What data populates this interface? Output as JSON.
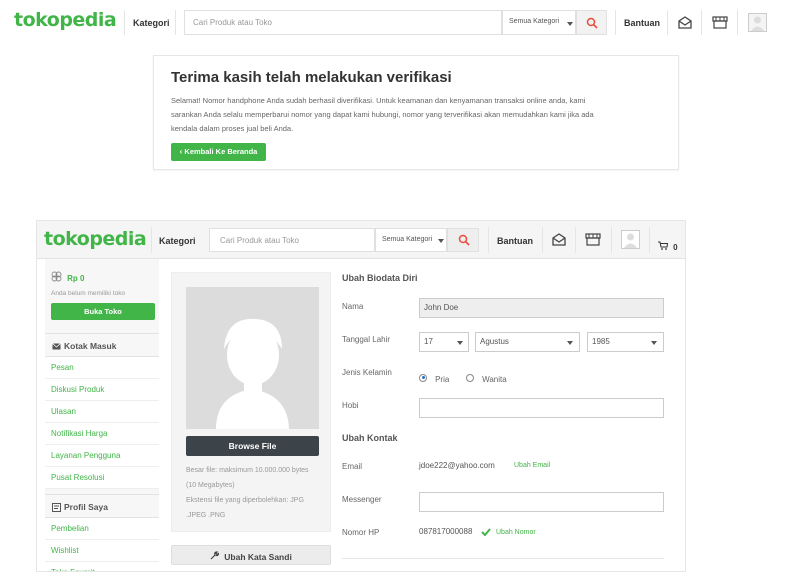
{
  "top_header": {
    "logo": "tokopedia",
    "kategori": "Kategori",
    "search_placeholder": "Cari Produk atau Toko",
    "category_select": "Semua Kategori",
    "bantuan": "Bantuan"
  },
  "verification": {
    "title": "Terima kasih telah melakukan verifikasi",
    "body_line1": "Selamat! Nomor handphone Anda sudah berhasil diverifikasi. Untuk keamanan dan kenyamanan transaksi online anda, kami",
    "body_line2": "sarankan Anda selalu memperbarui nomor yang dapat kami hubungi, nomor yang terverifikasi akan memudahkan kami jika ada",
    "body_line3": "kendala dalam proses jual beli Anda.",
    "back_button": "Kembali Ke Beranda"
  },
  "bottom_header": {
    "logo": "tokopedia",
    "kategori": "Kategori",
    "search_placeholder": "Cari Produk atau Toko",
    "category_select": "Semua Kategori",
    "bantuan": "Bantuan",
    "cart_count": "0"
  },
  "sidebar": {
    "balance": "Rp 0",
    "no_shop_text": "Anda belum memiliki toko",
    "open_shop_button": "Buka Toko",
    "inbox_title": "Kotak Masuk",
    "inbox_items": [
      "Pesan",
      "Diskusi Produk",
      "Ulasan",
      "Notifikasi Harga",
      "Layanan Pengguna",
      "Pusat Resolusi"
    ],
    "profile_title": "Profil Saya",
    "profile_items": [
      "Pembelian",
      "Wishlist",
      "Toko Favorit"
    ]
  },
  "photo": {
    "browse_button": "Browse File",
    "size_line1": "Besar file: maksimum 10.000.000 bytes",
    "size_line2": "(10 Megabytes)",
    "ext_line1": "Ekstensi file yang diperbolehkan: JPG",
    "ext_line2": ".JPEG .PNG",
    "change_password_button": "Ubah Kata Sandi"
  },
  "form": {
    "biodata_title": "Ubah Biodata Diri",
    "name_label": "Nama",
    "name_value": "John Doe",
    "birth_label": "Tanggal Lahir",
    "birth_day": "17",
    "birth_month": "Agustus",
    "birth_year": "1985",
    "gender_label": "Jenis Kelamin",
    "gender_male": "Pria",
    "gender_female": "Wanita",
    "gender_selected": "Pria",
    "hobby_label": "Hobi",
    "hobby_value": "",
    "contact_title": "Ubah Kontak",
    "email_label": "Email",
    "email_value": "jdoe222@yahoo.com",
    "change_email": "Ubah Email",
    "messenger_label": "Messenger",
    "messenger_value": "",
    "phone_label": "Nomor HP",
    "phone_value": "087817000088",
    "change_phone": "Ubah Nomor"
  },
  "colors": {
    "brand_green": "#42b549",
    "dark_button": "#3d4449",
    "search_icon_red": "#e94c3c"
  }
}
